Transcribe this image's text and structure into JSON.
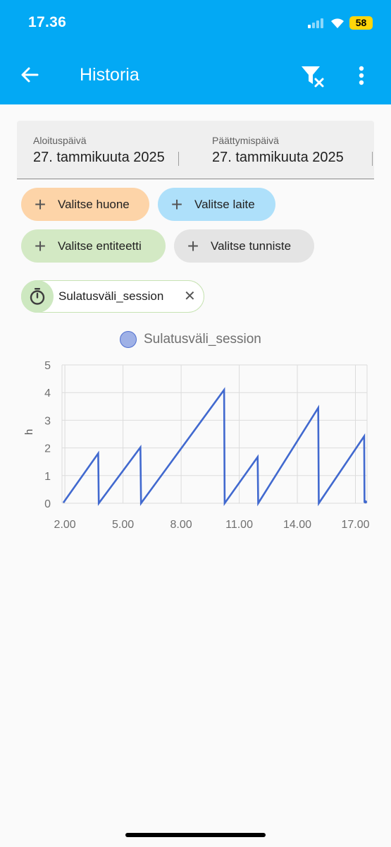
{
  "status_bar": {
    "time": "17.36",
    "battery": "58"
  },
  "app_bar": {
    "title": "Historia"
  },
  "dates": {
    "start_label": "Aloituspäivä",
    "start_value": "27. tammikuuta 2025",
    "end_label": "Päättymispäivä",
    "end_value": "27. tammikuuta 2025"
  },
  "chips": {
    "room": "Valitse huone",
    "device": "Valitse laite",
    "entity": "Valitse entiteetti",
    "tag": "Valitse tunniste"
  },
  "colors": {
    "app_bar": "#03a9f4",
    "room_chip": "#fdd4a8",
    "device_chip": "#aee0fa",
    "entity_chip": "#d3e9c4",
    "tag_chip": "#e4e4e4",
    "series": "#4169cf"
  },
  "selected_entity": {
    "label": "Sulatusväli_session"
  },
  "chart_data": {
    "type": "line",
    "legend": "Sulatusväli_session",
    "ylabel": "h",
    "xlabel": "",
    "ylim": [
      0,
      5
    ],
    "xlim": [
      1.85,
      17.6
    ],
    "y_ticks": [
      "0",
      "1",
      "2",
      "3",
      "4",
      "5"
    ],
    "x_ticks": [
      {
        "value": 2,
        "label": "2.00"
      },
      {
        "value": 5,
        "label": "5.00"
      },
      {
        "value": 8,
        "label": "8.00"
      },
      {
        "value": 11,
        "label": "11.00"
      },
      {
        "value": 14,
        "label": "14.00"
      },
      {
        "value": 17,
        "label": "17.00"
      }
    ],
    "grid": true,
    "series": [
      {
        "name": "Sulatusväli_session",
        "points": [
          [
            1.92,
            0.02
          ],
          [
            3.72,
            1.8
          ],
          [
            3.75,
            0.0
          ],
          [
            5.9,
            2.02
          ],
          [
            5.93,
            0.0
          ],
          [
            10.22,
            4.1
          ],
          [
            10.25,
            0.0
          ],
          [
            11.95,
            1.67
          ],
          [
            11.98,
            0.0
          ],
          [
            15.08,
            3.45
          ],
          [
            15.11,
            0.0
          ],
          [
            17.45,
            2.42
          ],
          [
            17.47,
            0.05
          ],
          [
            17.52,
            0.05
          ]
        ]
      }
    ]
  }
}
